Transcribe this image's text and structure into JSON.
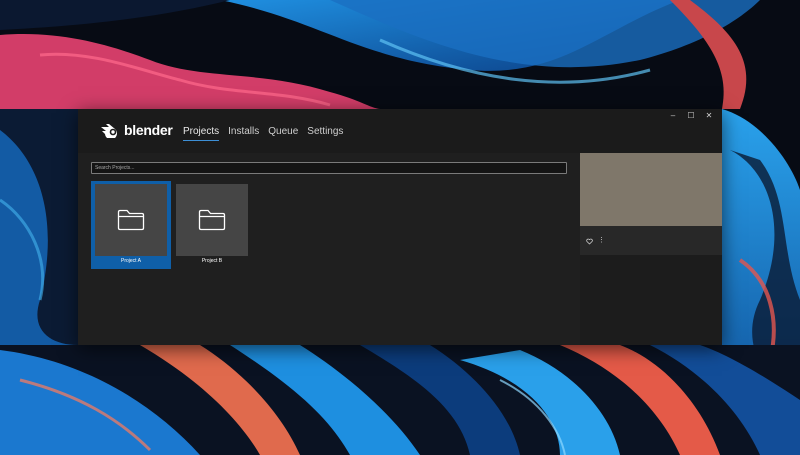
{
  "app": {
    "logo_text": "blender"
  },
  "nav": {
    "tabs": [
      {
        "label": "Projects",
        "active": true
      },
      {
        "label": "Installs",
        "active": false
      },
      {
        "label": "Queue",
        "active": false
      },
      {
        "label": "Settings",
        "active": false
      }
    ]
  },
  "window_controls": {
    "minimize": "–",
    "maximize": "☐",
    "close": "✕"
  },
  "search": {
    "placeholder": "Search Projects...",
    "value": ""
  },
  "projects": [
    {
      "name": "Project A",
      "selected": true
    },
    {
      "name": "Project B",
      "selected": false
    }
  ],
  "side_panel": {
    "preview_color": "#7f776a",
    "favorite_icon": "heart-icon",
    "more_label": "⋮"
  },
  "colors": {
    "accent": "#3d8fd6",
    "selection": "#0f5fa8"
  }
}
